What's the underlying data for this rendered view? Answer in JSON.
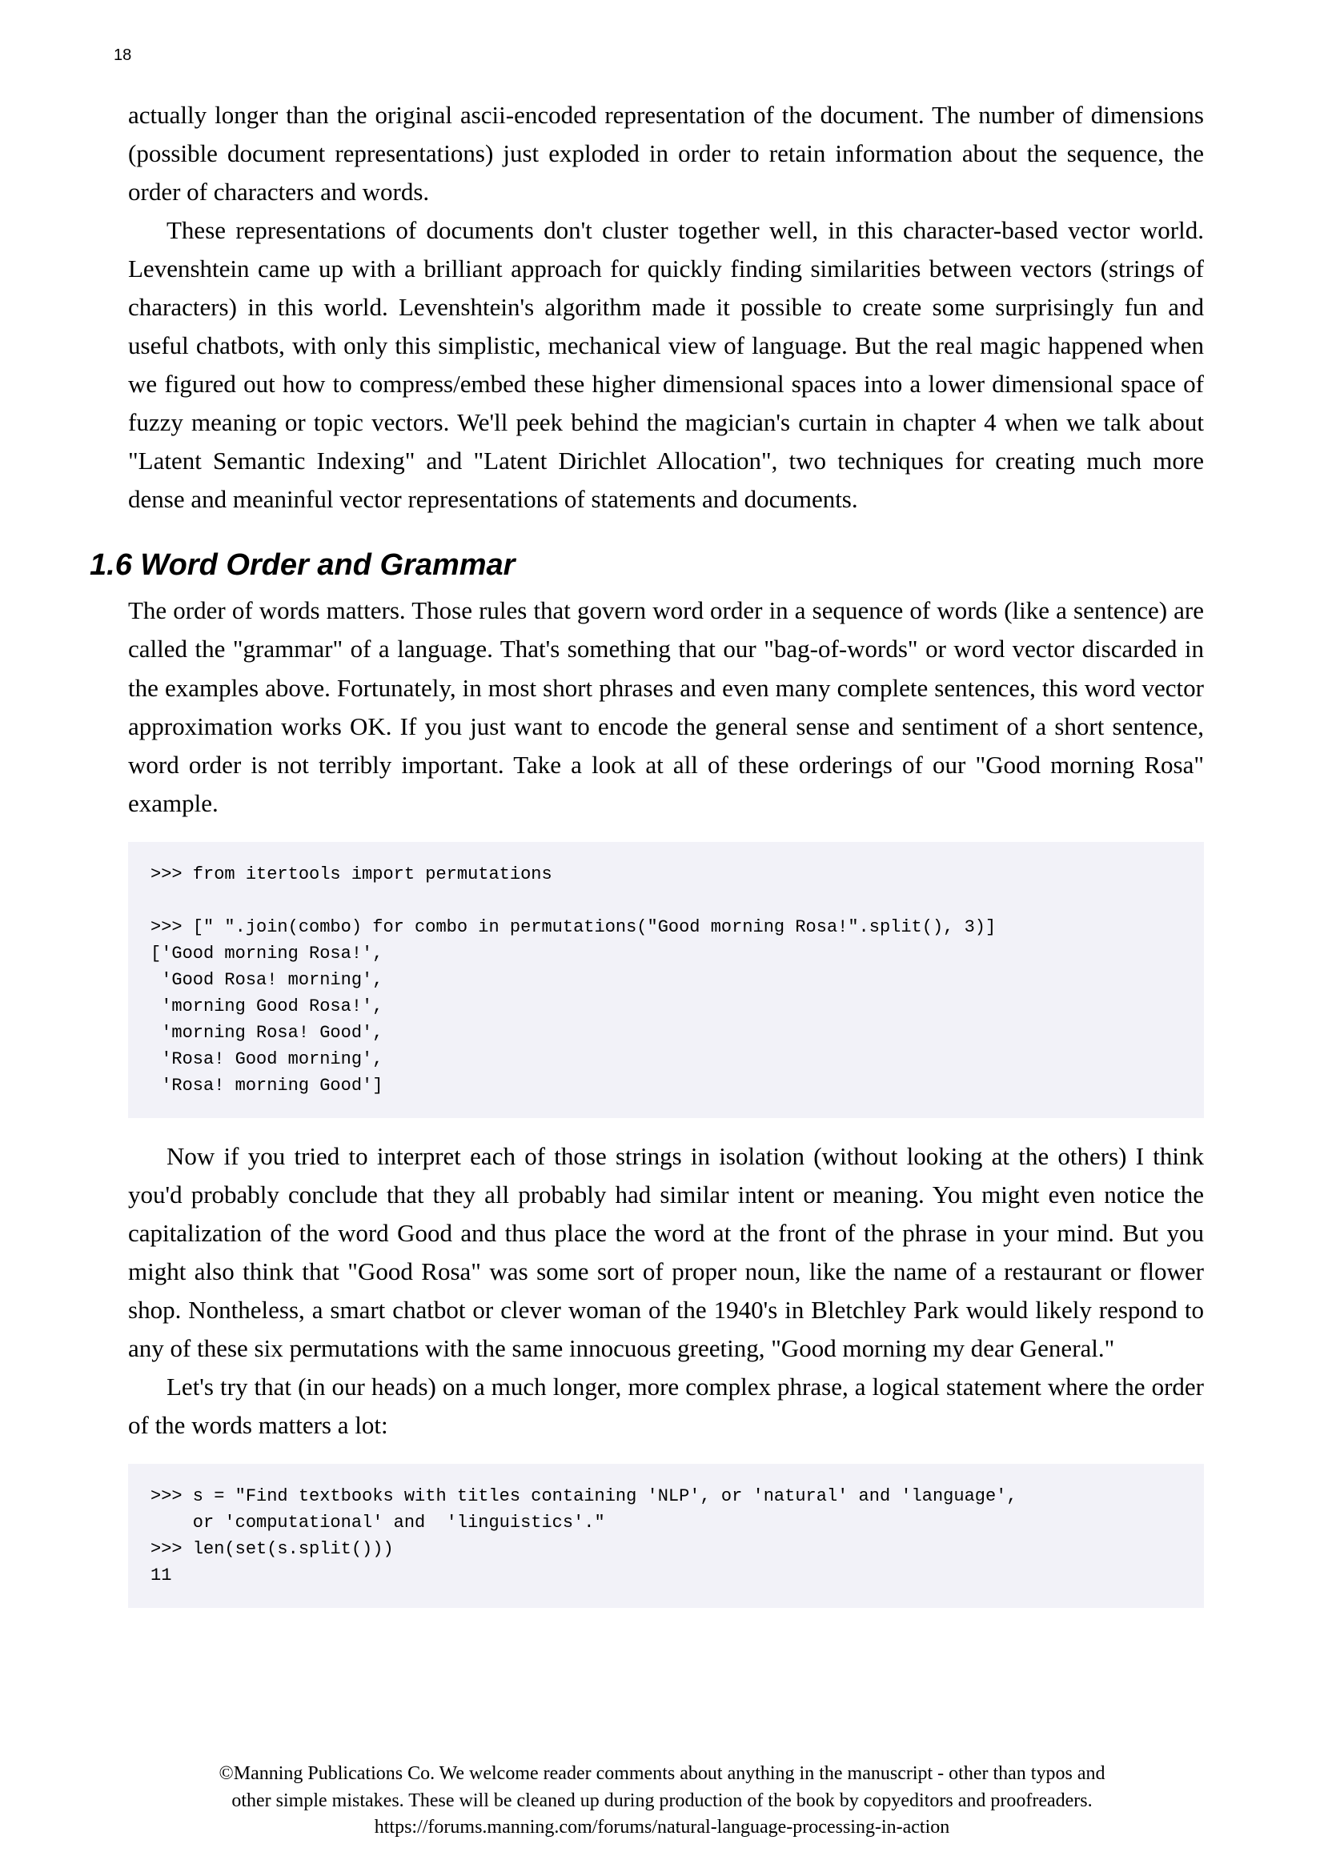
{
  "pageNumber": "18",
  "para1": "actually longer than the original ascii-encoded representation of the document. The number of dimensions (possible document representations) just exploded in order to retain information about the sequence, the order of characters and words.",
  "para2": "These representations of documents don't cluster together well, in this character-based vector world. Levenshtein came up with a brilliant approach for quickly finding similarities between vectors (strings of characters) in this world. Levenshtein's algorithm made it possible to create some surprisingly fun and useful chatbots, with only this simplistic, mechanical view of language. But the real magic happened when we figured out how to compress/embed these higher dimensional spaces into a lower dimensional space of fuzzy meaning or topic vectors. We'll peek behind the magician's curtain in chapter 4 when we talk about \"Latent Semantic Indexing\" and \"Latent Dirichlet Allocation\", two techniques for creating much more dense and meaninful vector representations of statements and documents.",
  "heading": "1.6 Word Order and Grammar",
  "para3": "The order of words matters. Those rules that govern word order in a sequence of words (like a sentence) are called the \"grammar\" of a language. That's something that our \"bag-of-words\" or word vector discarded in the examples above. Fortunately, in most short phrases and even many complete sentences, this word vector approximation works OK. If you just want to encode the general sense and sentiment of a short sentence, word order is not terribly important. Take a look at all of these orderings of our \"Good morning Rosa\" example.",
  "code1": ">>> from itertools import permutations\n\n>>> [\" \".join(combo) for combo in permutations(\"Good morning Rosa!\".split(), 3)]\n['Good morning Rosa!',\n 'Good Rosa! morning',\n 'morning Good Rosa!',\n 'morning Rosa! Good',\n 'Rosa! Good morning',\n 'Rosa! morning Good']",
  "para4": "Now if you tried to interpret each of those strings in isolation (without looking at the others) I think you'd probably conclude that they all probably had similar intent or meaning. You might even notice the capitalization of the word Good and thus place the word at the front of the phrase in your mind. But you might also think that \"Good Rosa\" was some sort of proper noun, like the name of a restaurant or flower shop. Nontheless, a smart chatbot or clever woman of the 1940's in Bletchley Park would likely respond to any of these six permutations with the same innocuous greeting, \"Good morning my dear General.\"",
  "para5": "Let's try that (in our heads) on a much longer, more complex phrase, a logical statement where the order of the words matters a lot:",
  "code2": ">>> s = \"Find textbooks with titles containing 'NLP', or 'natural' and 'language',\n    or 'computational' and  'linguistics'.\"\n>>> len(set(s.split()))\n11",
  "footer1": "©Manning Publications Co. We welcome reader comments about anything in the manuscript - other than typos and",
  "footer2": "other simple mistakes. These will be cleaned up during production of the book by copyeditors and proofreaders.",
  "footer3": "https://forums.manning.com/forums/natural-language-processing-in-action"
}
